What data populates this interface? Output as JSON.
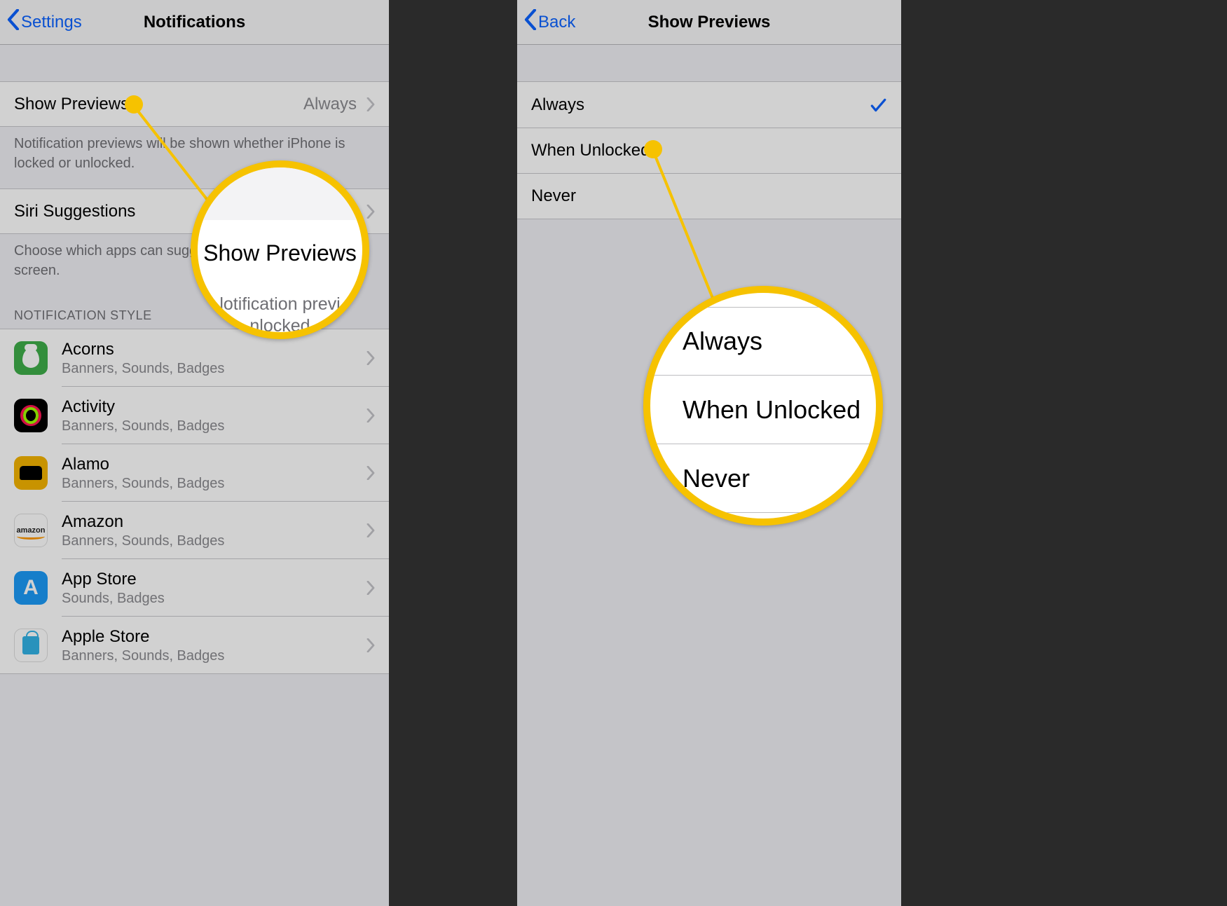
{
  "left": {
    "nav": {
      "back": "Settings",
      "title": "Notifications"
    },
    "showPreviews": {
      "label": "Show Previews",
      "value": "Always"
    },
    "showPreviewsFooter": "Notification previews will be shown whether iPhone is locked or unlocked.",
    "siri": {
      "label": "Siri Suggestions"
    },
    "siriFooter": "Choose which apps can suggest Shortcuts on the lock screen.",
    "styleHeader": "NOTIFICATION STYLE",
    "apps": [
      {
        "name": "Acorns",
        "sub": "Banners, Sounds, Badges",
        "iconClass": "ic-acorns"
      },
      {
        "name": "Activity",
        "sub": "Banners, Sounds, Badges",
        "iconClass": "ic-activity"
      },
      {
        "name": "Alamo",
        "sub": "Banners, Sounds, Badges",
        "iconClass": "ic-alamo"
      },
      {
        "name": "Amazon",
        "sub": "Banners, Sounds, Badges",
        "iconClass": "ic-amazon"
      },
      {
        "name": "App Store",
        "sub": "Sounds, Badges",
        "iconClass": "ic-appstore"
      },
      {
        "name": "Apple Store",
        "sub": "Banners, Sounds, Badges",
        "iconClass": "ic-applestore"
      }
    ],
    "callout": {
      "title": "Show Previews",
      "footer1": "lotification previ",
      "footer2": "nlocked"
    }
  },
  "right": {
    "nav": {
      "back": "Back",
      "title": "Show Previews"
    },
    "options": [
      {
        "label": "Always",
        "selected": true
      },
      {
        "label": "When Unlocked",
        "selected": false
      },
      {
        "label": "Never",
        "selected": false
      }
    ],
    "callout": {
      "rows": [
        "Always",
        "When Unlocked",
        "Never"
      ]
    }
  }
}
